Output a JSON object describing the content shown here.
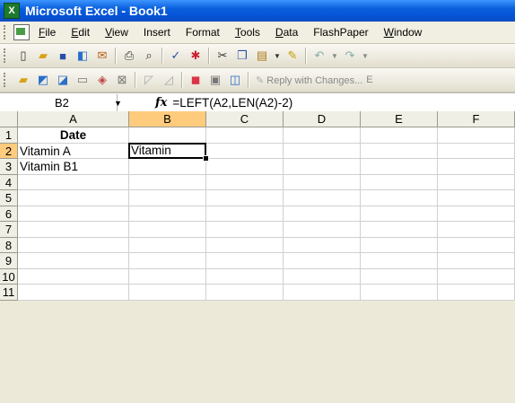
{
  "window": {
    "title": "Microsoft Excel - Book1",
    "app_icon": "excel-icon"
  },
  "menubar": {
    "items": [
      {
        "label": "File",
        "ul": "F"
      },
      {
        "label": "Edit",
        "ul": "E"
      },
      {
        "label": "View",
        "ul": "V"
      },
      {
        "label": "Insert",
        "ul": ""
      },
      {
        "label": "Format",
        "ul": ""
      },
      {
        "label": "Tools",
        "ul": "T"
      },
      {
        "label": "Data",
        "ul": "D"
      },
      {
        "label": "FlashPaper",
        "ul": ""
      },
      {
        "label": "Window",
        "ul": "W"
      }
    ]
  },
  "toolbar_standard": {
    "icons": [
      "new-icon",
      "open-icon",
      "save-icon",
      "permission-icon",
      "print-preview-icon",
      "print-icon",
      "print-preview-icon",
      "spelling-icon",
      "research-icon",
      "cut-icon",
      "copy-icon",
      "paste-icon",
      "format-painter-icon",
      "undo-icon",
      "redo-icon"
    ]
  },
  "toolbar_reviewing": {
    "reply_label": "Reply with Changes...",
    "reply_suffix": "E"
  },
  "formula_bar": {
    "name_box": "B2",
    "fx_label": "fx",
    "formula": "=LEFT(A2,LEN(A2)-2)"
  },
  "sheet": {
    "columns": [
      "A",
      "B",
      "C",
      "D",
      "E",
      "F"
    ],
    "active_column": "B",
    "rows": [
      "1",
      "2",
      "3",
      "4",
      "5",
      "6",
      "7",
      "8",
      "9",
      "10",
      "11"
    ],
    "active_row": "2",
    "cells": {
      "A1": "Date",
      "A2": "Vitamin A",
      "B2": "Vitamin",
      "A3": "Vitamin B1"
    },
    "selected_cell": "B2"
  }
}
